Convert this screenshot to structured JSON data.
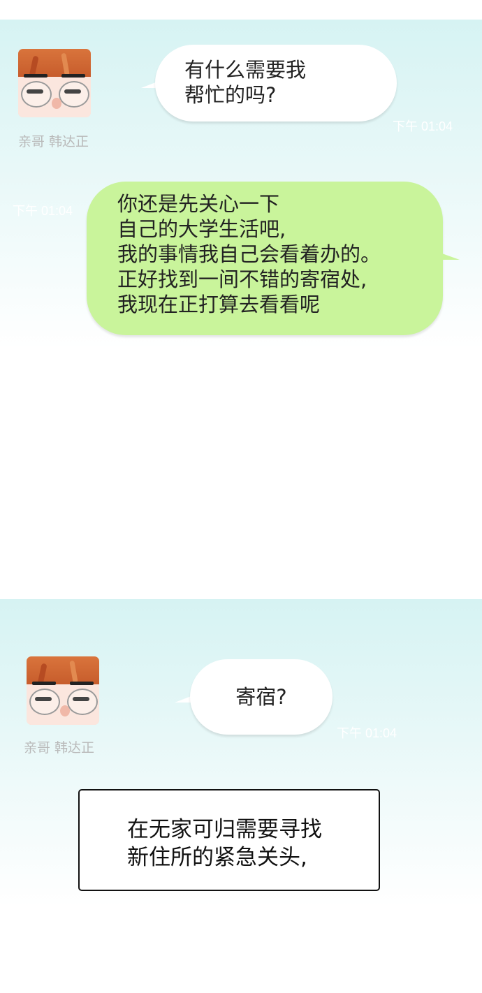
{
  "panel1": {
    "sender_name": "亲哥 韩达正",
    "incoming_message": "有什么需要我\n帮忙的吗?",
    "incoming_time": "下午 01:04",
    "outgoing_time": "下午 01:04",
    "outgoing_message": "你还是先关心一下\n自己的大学生活吧,\n我的事情我自己会看着办的。\n正好找到一间不错的寄宿处,\n我现在正打算去看看呢"
  },
  "panel2": {
    "sender_name": "亲哥 韩达正",
    "incoming_message": "寄宿?",
    "incoming_time": "下午 01:04",
    "caption": "在无家可归需要寻找\n新住所的紧急关头,"
  },
  "colors": {
    "panel_top": "#d6f3f3",
    "outgoing_bubble": "#c9f49b",
    "incoming_bubble": "#ffffff"
  },
  "icons": {
    "sender_avatar": "avatar-icon"
  }
}
